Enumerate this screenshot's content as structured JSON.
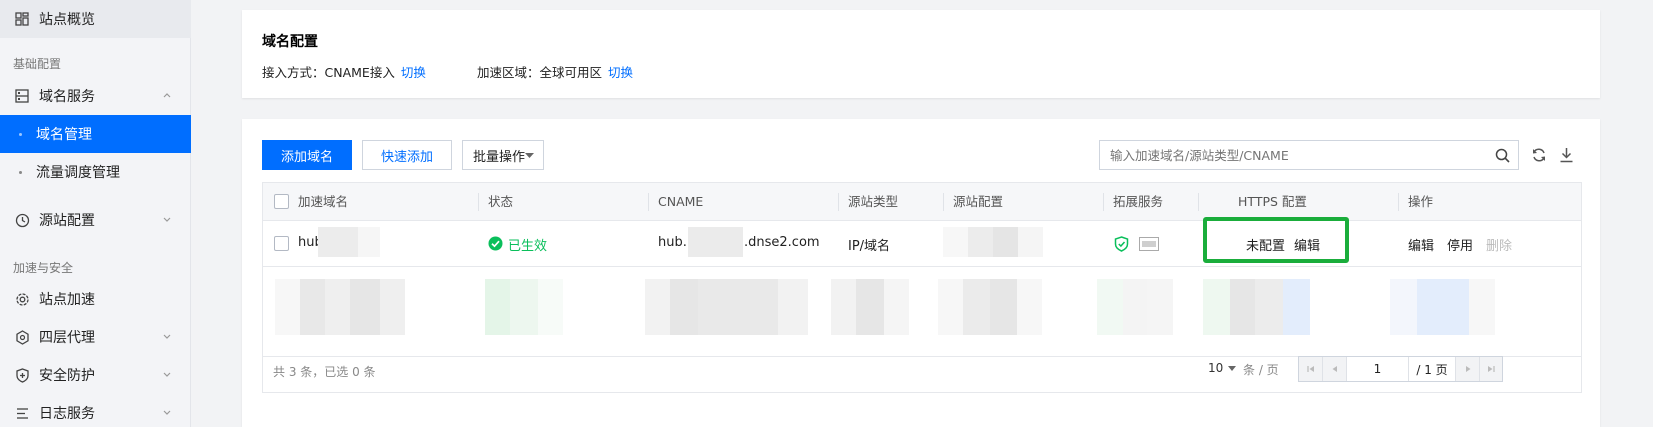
{
  "sidebar": {
    "overview": "站点概览",
    "group_basic": "基础配置",
    "domain_service": "域名服务",
    "domain_manage": "域名管理",
    "traffic_manage": "流量调度管理",
    "origin_config": "源站配置",
    "group_security": "加速与安全",
    "site_accel": "站点加速",
    "l4_proxy": "四层代理",
    "security": "安全防护",
    "log_service": "日志服务"
  },
  "domain_config": {
    "title": "域名配置",
    "access_label": "接入方式：CNAME接入",
    "access_switch": "切换",
    "region_label": "加速区域：全球可用区",
    "region_switch": "切换"
  },
  "toolbar": {
    "add_domain": "添加域名",
    "quick_add": "快速添加",
    "batch_ops": "批量操作",
    "search_placeholder": "输入加速域名/源站类型/CNAME"
  },
  "table": {
    "headers": {
      "domain": "加速域名",
      "status": "状态",
      "cname": "CNAME",
      "origin_type": "源站类型",
      "origin_config": "源站配置",
      "ext": "拓展服务",
      "https": "HTTPS 配置",
      "ops": "操作"
    },
    "row1": {
      "domain": "hub",
      "status": "已生效",
      "cname_prefix": "hub.",
      "cname_suffix": ".dnse2.com",
      "origin_type": "IP/域名",
      "https_status": "未配置",
      "https_edit": "编辑",
      "op_edit": "编辑",
      "op_disable": "停用",
      "op_delete": "删除"
    }
  },
  "footer": {
    "summary": "共 3 条，已选 0 条",
    "page_size": "10",
    "page_size_unit": "条 / 页",
    "page_input": "1",
    "page_total": "/ 1 页"
  },
  "colors": {
    "accent": "#006eff",
    "success": "#0abf5b",
    "highlight_box": "#1aad3b"
  }
}
